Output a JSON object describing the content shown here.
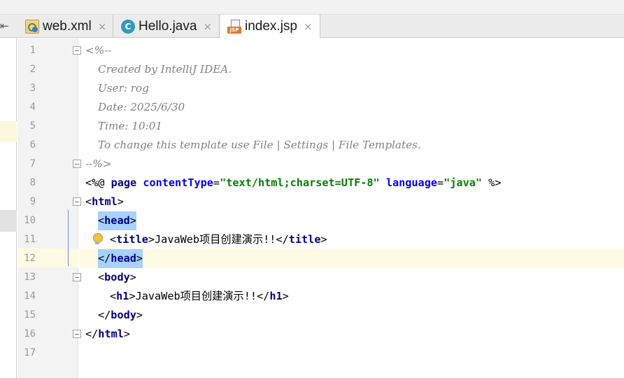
{
  "tabs": [
    {
      "label": "web.xml",
      "icon": "xml-file-icon",
      "active": false
    },
    {
      "label": "Hello.java",
      "icon": "java-class-icon",
      "active": false
    },
    {
      "label": "index.jsp",
      "icon": "jsp-file-icon",
      "active": true
    }
  ],
  "tab_icon_labels": {
    "java": "C",
    "jsp": "JSP"
  },
  "close_glyph": "×",
  "collapse_glyph": "⇤",
  "line_numbers": [
    "1",
    "2",
    "3",
    "4",
    "5",
    "6",
    "7",
    "8",
    "9",
    "10",
    "11",
    "12",
    "13",
    "14",
    "15",
    "16",
    "17"
  ],
  "code": {
    "l1_open": "<%--",
    "l2": "Created by IntelliJ IDEA.",
    "l3": "User: rog",
    "l4": "Date: 2025/6/30",
    "l5": "Time: 10:01",
    "l6": "To change this template use File | Settings | File Templates.",
    "l7_close": "--%>",
    "l8_open": "<%@",
    "l8_directive": "page",
    "l8_attr1": "contentType",
    "l8_val1": "\"text/html;charset=UTF-8\"",
    "l8_attr2": "language",
    "l8_val2": "\"java\"",
    "l8_close": "%>",
    "tag_html": "html",
    "tag_head": "head",
    "tag_title": "title",
    "tag_body": "body",
    "tag_h1": "h1",
    "title_text": "JavaWeb项目创建演示!!",
    "h1_text": "JavaWeb项目创建演示!!",
    "lt": "<",
    "gt": ">",
    "lt_slash": "</",
    "eq": "="
  },
  "colors": {
    "tag": "#000080",
    "attr": "#0000ff",
    "value": "#008000",
    "comment": "#808080",
    "caret_line": "#fffae3",
    "brace_match": "#a8d1ff"
  }
}
